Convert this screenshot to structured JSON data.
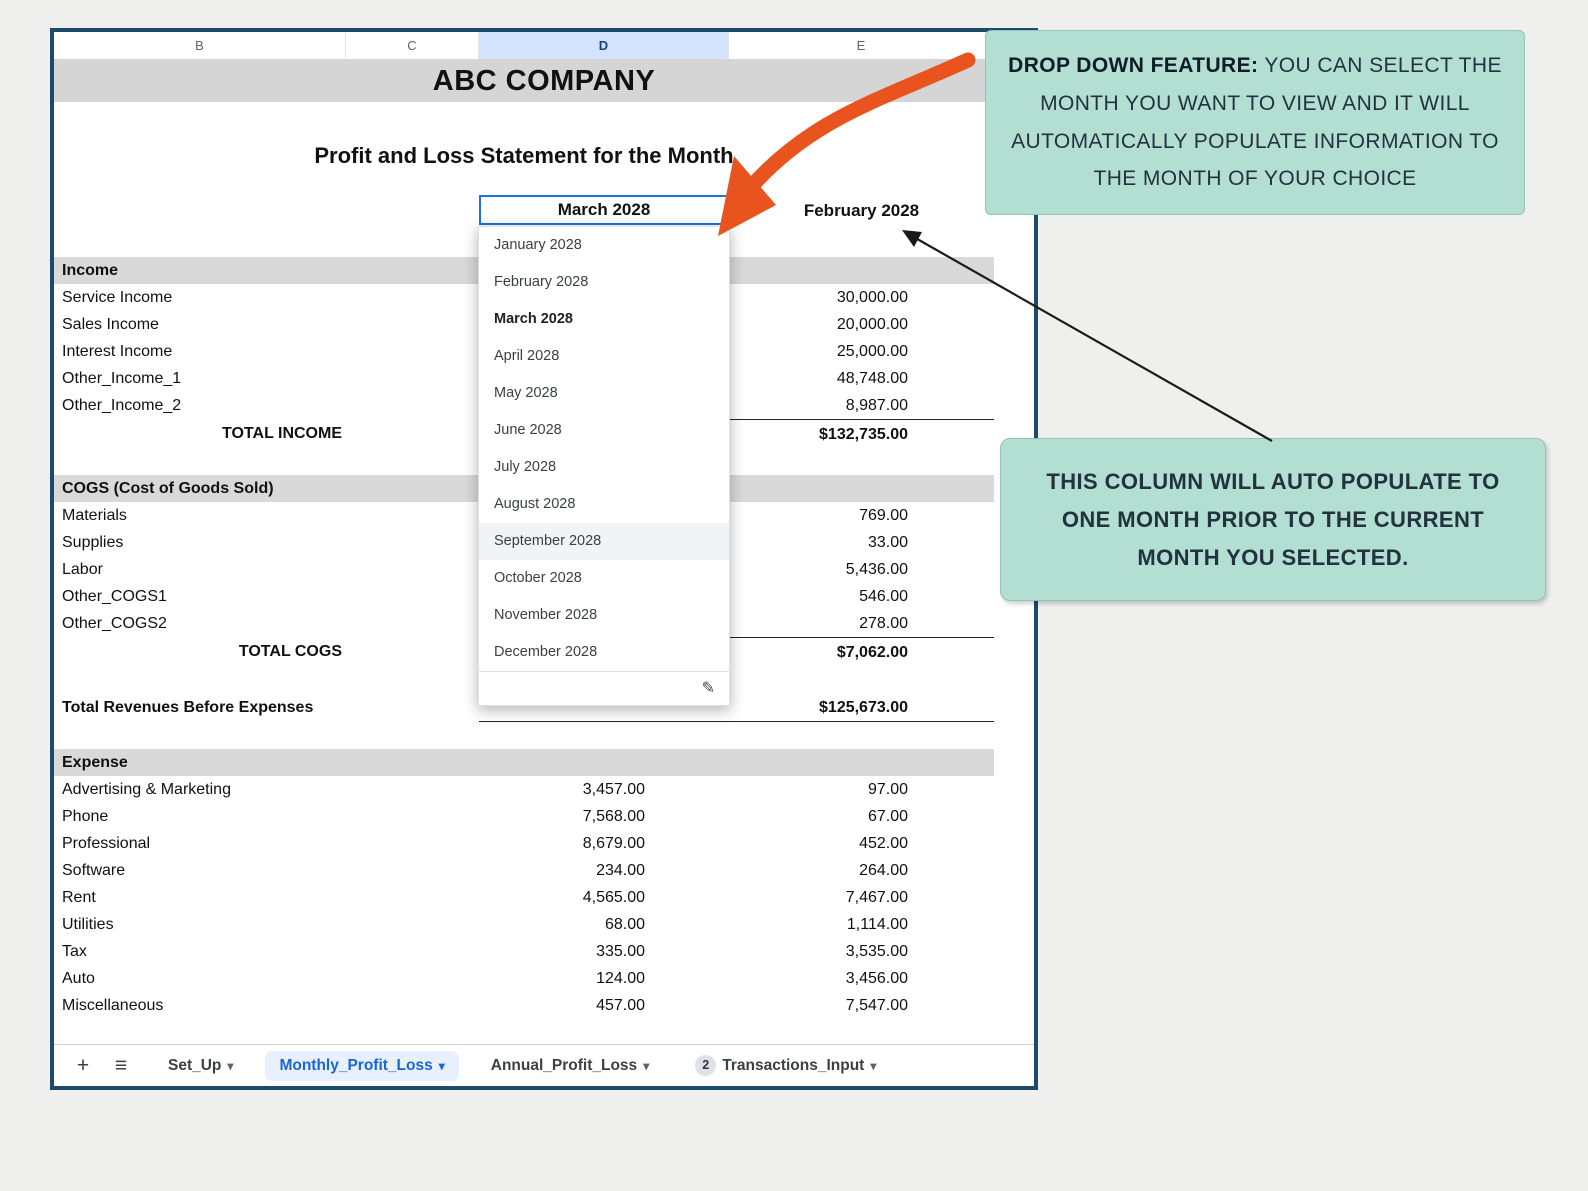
{
  "colors": {
    "accent_blue": "#1a73e8",
    "window_border": "#1b4a6b",
    "callout_bg": "#b3ded2",
    "arrow_orange": "#e8531e",
    "column_highlight": "#d3e3fd"
  },
  "icons": {
    "plus": "+",
    "menu": "≡",
    "caret": "▾",
    "edit": "✎"
  },
  "sheet": {
    "columns": [
      "B",
      "C",
      "D",
      "E"
    ],
    "company_name": "ABC COMPANY",
    "statement_title": "Profit and Loss Statement for the Month",
    "current_month": "March 2028",
    "prior_month": "February 2028"
  },
  "dropdown": {
    "selected": "March 2028",
    "highlighted": "September 2028",
    "options": [
      "January 2028",
      "February 2028",
      "March 2028",
      "April 2028",
      "May 2028",
      "June 2028",
      "July 2028",
      "August 2028",
      "September 2028",
      "October 2028",
      "November 2028",
      "December 2028"
    ]
  },
  "sections": {
    "income": {
      "header": "Income",
      "rows": [
        {
          "label": "Service Income",
          "e": "30,000.00"
        },
        {
          "label": "Sales Income",
          "e": "20,000.00"
        },
        {
          "label": "Interest Income",
          "e": "25,000.00"
        },
        {
          "label": "Other_Income_1",
          "e": "48,748.00"
        },
        {
          "label": "Other_Income_2",
          "e": "8,987.00"
        }
      ],
      "total_label": "TOTAL INCOME",
      "total": "$132,735.00"
    },
    "cogs": {
      "header": "COGS (Cost of Goods Sold)",
      "rows": [
        {
          "label": "Materials",
          "e": "769.00"
        },
        {
          "label": "Supplies",
          "e": "33.00"
        },
        {
          "label": "Labor",
          "e": "5,436.00"
        },
        {
          "label": "Other_COGS1",
          "e": "546.00"
        },
        {
          "label": "Other_COGS2",
          "e": "278.00"
        }
      ],
      "total_label": "TOTAL COGS",
      "total": "$7,062.00"
    },
    "revenue": {
      "label": "Total Revenues Before Expenses",
      "total": "$125,673.00"
    },
    "expense": {
      "header": "Expense",
      "rows": [
        {
          "label": "Advertising & Marketing",
          "d": "3,457.00",
          "e": "97.00"
        },
        {
          "label": "Phone",
          "d": "7,568.00",
          "e": "67.00"
        },
        {
          "label": "Professional",
          "d": "8,679.00",
          "e": "452.00"
        },
        {
          "label": "Software",
          "d": "234.00",
          "e": "264.00"
        },
        {
          "label": "Rent",
          "d": "4,565.00",
          "e": "7,467.00"
        },
        {
          "label": "Utilities",
          "d": "68.00",
          "e": "1,114.00"
        },
        {
          "label": "Tax",
          "d": "335.00",
          "e": "3,535.00"
        },
        {
          "label": "Auto",
          "d": "124.00",
          "e": "3,456.00"
        },
        {
          "label": "Miscellaneous",
          "d": "457.00",
          "e": "7,547.00"
        }
      ]
    }
  },
  "tabs": {
    "items": [
      {
        "label": "Set_Up"
      },
      {
        "label": "Monthly_Profit_Loss",
        "active": true
      },
      {
        "label": "Annual_Profit_Loss"
      },
      {
        "label": "Transactions_Input",
        "badge": "2"
      }
    ]
  },
  "callouts": {
    "dropdown_feature": {
      "bold": "DROP DOWN FEATURE:",
      "text": "YOU CAN SELECT THE MONTH YOU WANT TO VIEW AND IT WILL AUTOMATICALLY POPULATE INFORMATION TO THE MONTH OF YOUR CHOICE"
    },
    "auto_populate": {
      "text": "THIS COLUMN WILL AUTO POPULATE TO ONE MONTH PRIOR TO THE CURRENT MONTH YOU SELECTED."
    }
  }
}
